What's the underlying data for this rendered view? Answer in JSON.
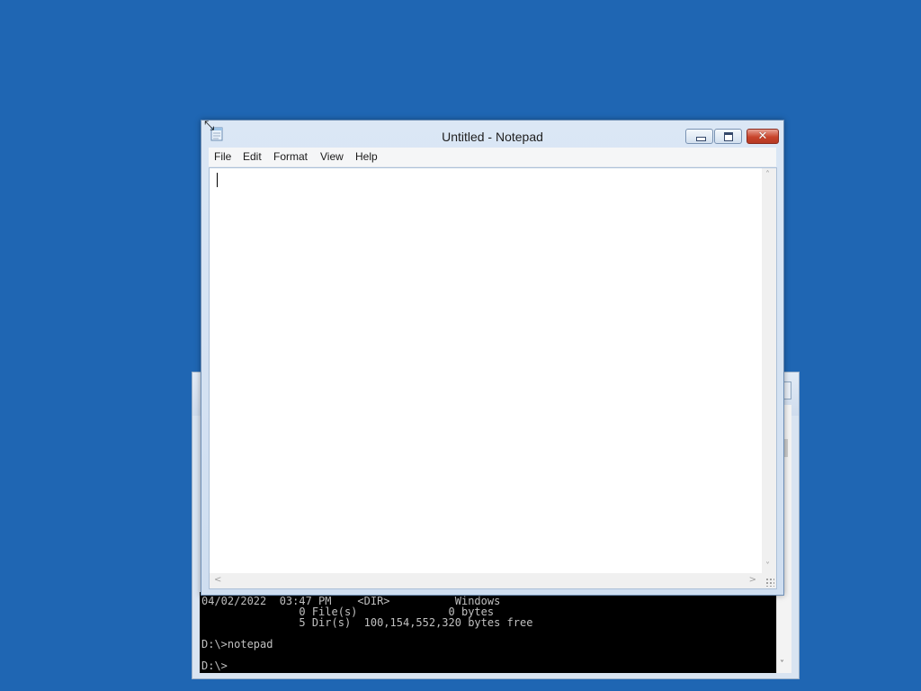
{
  "desktop": {
    "background_color": "#1f66b3"
  },
  "notepad": {
    "title": "Untitled - Notepad",
    "menu": [
      "File",
      "Edit",
      "Format",
      "View",
      "Help"
    ],
    "content": "",
    "icons": {
      "app": "notepad-icon",
      "minimize": "minimize-icon",
      "maximize": "maximize-icon",
      "close": "close-icon",
      "close_glyph": "✕",
      "resize_cursor": "resize-diagonal-icon",
      "resize_cursor_glyph": "⤡",
      "scroll_up_glyph": "˄",
      "scroll_down_glyph": "˅",
      "scroll_left_glyph": "<",
      "scroll_right_glyph": ">"
    },
    "colors": {
      "close_button": "#c8442c",
      "editor_background": "#ffffff"
    }
  },
  "console": {
    "lines": [
      "04/02/2022  03:47 PM    <DIR>          Windows",
      "               0 File(s)              0 bytes",
      "               5 Dir(s)  100,154,552,320 bytes free",
      "",
      "D:\\>notepad",
      "",
      "D:\\>"
    ],
    "icons": {
      "scroll_up_glyph": "˄",
      "scroll_down_glyph": "˅"
    },
    "colors": {
      "background": "#000000",
      "text": "#c0c0c0"
    }
  }
}
